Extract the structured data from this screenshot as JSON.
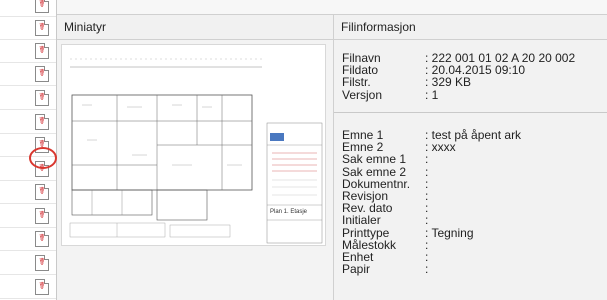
{
  "headers": {
    "thumbnail": "Miniatyr",
    "fileinfo": "Filinformasjon"
  },
  "file_info": [
    {
      "key": "Filnavn",
      "value": ": 222 001 01 02 A 20 20 002"
    },
    {
      "key": "Fildato",
      "value": ": 20.04.2015 09:10"
    },
    {
      "key": "Filstr.",
      "value": ": 329 KB"
    },
    {
      "key": "Versjon",
      "value": ": 1"
    }
  ],
  "meta_info": [
    {
      "key": "Emne 1",
      "value": ": test på åpent ark"
    },
    {
      "key": "Emne 2",
      "value": ": xxxx"
    },
    {
      "key": "Sak emne 1",
      "value": ":"
    },
    {
      "key": "Sak emne 2",
      "value": ":"
    },
    {
      "key": "Dokumentnr.",
      "value": ":"
    },
    {
      "key": "Revisjon",
      "value": ":"
    },
    {
      "key": "Rev. dato",
      "value": ":"
    },
    {
      "key": "Initialer",
      "value": ":"
    },
    {
      "key": "Printtype",
      "value": ": Tegning"
    },
    {
      "key": "Målestokk",
      "value": ":"
    },
    {
      "key": "Enhet",
      "value": ":"
    },
    {
      "key": "Papir",
      "value": ":"
    }
  ],
  "thumbnail_text": {
    "plan_title": "Plan 1. Etasje"
  },
  "icons": {
    "file_icon": "pdf-file-icon",
    "highlight_color": "#d9372f"
  }
}
